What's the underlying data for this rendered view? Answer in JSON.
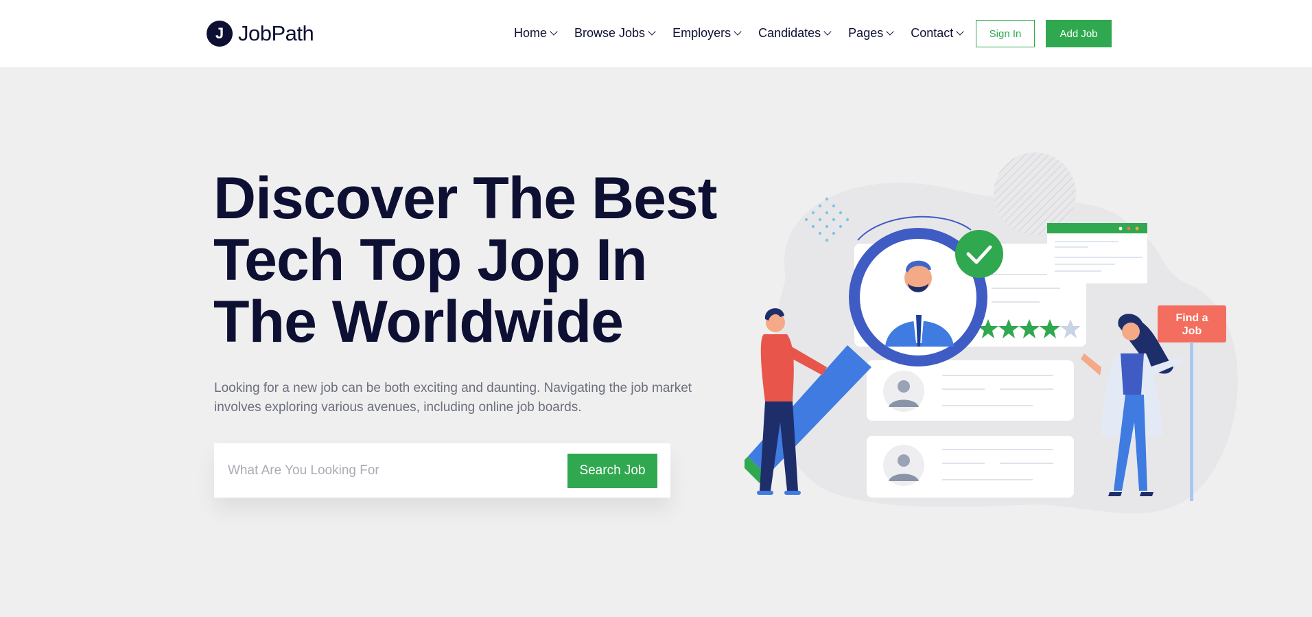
{
  "header": {
    "logo_letter": "J",
    "logo_text": "JobPath",
    "nav": [
      {
        "label": "Home"
      },
      {
        "label": "Browse Jobs"
      },
      {
        "label": "Employers"
      },
      {
        "label": "Candidates"
      },
      {
        "label": "Pages"
      },
      {
        "label": "Contact"
      }
    ],
    "signin_label": "Sign In",
    "addjob_label": "Add Job"
  },
  "hero": {
    "title_line1": "Discover The Best",
    "title_line2": "Tech Top Jop In",
    "title_line3": "The Worldwide",
    "description": "Looking for a new job can be both exciting and daunting. Navigating the job market involves exploring various avenues, including online job boards.",
    "search_placeholder": "What Are You Looking For",
    "search_button": "Search Job"
  },
  "illustration": {
    "sign_line1": "Find a",
    "sign_line2": "Job",
    "rating_filled_stars": 4,
    "rating_total_stars": 5
  },
  "colors": {
    "accent": "#2fa84f",
    "dark": "#0d1033",
    "background": "#efefef",
    "sign": "#f36e5e",
    "magnifier": "#3f5bc4"
  }
}
